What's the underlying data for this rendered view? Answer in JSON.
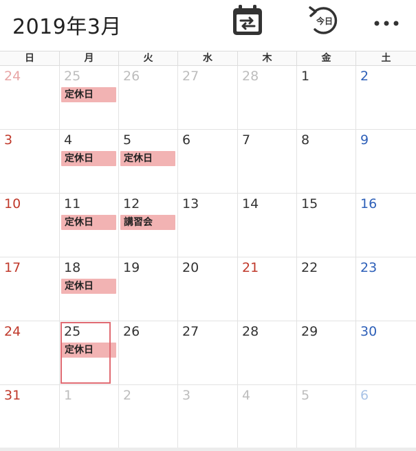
{
  "header": {
    "title": "2019年3月",
    "today_label": "今日",
    "icons": {
      "sync": "calendar-sync-icon",
      "today": "today-icon",
      "more": "more-icon"
    }
  },
  "weekdays": [
    "日",
    "月",
    "火",
    "水",
    "木",
    "金",
    "土"
  ],
  "colors": {
    "sunday": "#c0392b",
    "saturday": "#2d5fb8",
    "weekday": "#333333",
    "holiday": "#c0392b",
    "sunday_other": "#e8a5a5",
    "saturday_other": "#a9c3e6",
    "weekday_other": "#bdbdbd",
    "event_bg": "#f2b3b3",
    "today_border": "#e06a72"
  },
  "weeks": [
    [
      {
        "day": "24",
        "other": true
      },
      {
        "day": "25",
        "other": true,
        "event": "定休日"
      },
      {
        "day": "26",
        "other": true
      },
      {
        "day": "27",
        "other": true
      },
      {
        "day": "28",
        "other": true
      },
      {
        "day": "1"
      },
      {
        "day": "2"
      }
    ],
    [
      {
        "day": "3"
      },
      {
        "day": "4",
        "event": "定休日"
      },
      {
        "day": "5",
        "event": "定休日"
      },
      {
        "day": "6"
      },
      {
        "day": "7"
      },
      {
        "day": "8"
      },
      {
        "day": "9"
      }
    ],
    [
      {
        "day": "10"
      },
      {
        "day": "11",
        "event": "定休日"
      },
      {
        "day": "12",
        "event": "講習会"
      },
      {
        "day": "13"
      },
      {
        "day": "14"
      },
      {
        "day": "15"
      },
      {
        "day": "16"
      }
    ],
    [
      {
        "day": "17"
      },
      {
        "day": "18",
        "event": "定休日"
      },
      {
        "day": "19"
      },
      {
        "day": "20"
      },
      {
        "day": "21",
        "holiday": true
      },
      {
        "day": "22"
      },
      {
        "day": "23"
      }
    ],
    [
      {
        "day": "24"
      },
      {
        "day": "25",
        "event": "定休日",
        "today": true
      },
      {
        "day": "26"
      },
      {
        "day": "27"
      },
      {
        "day": "28"
      },
      {
        "day": "29"
      },
      {
        "day": "30"
      }
    ],
    [
      {
        "day": "31"
      },
      {
        "day": "1",
        "other": true
      },
      {
        "day": "2",
        "other": true
      },
      {
        "day": "3",
        "other": true
      },
      {
        "day": "4",
        "other": true
      },
      {
        "day": "5",
        "other": true
      },
      {
        "day": "6",
        "other": true
      }
    ]
  ]
}
